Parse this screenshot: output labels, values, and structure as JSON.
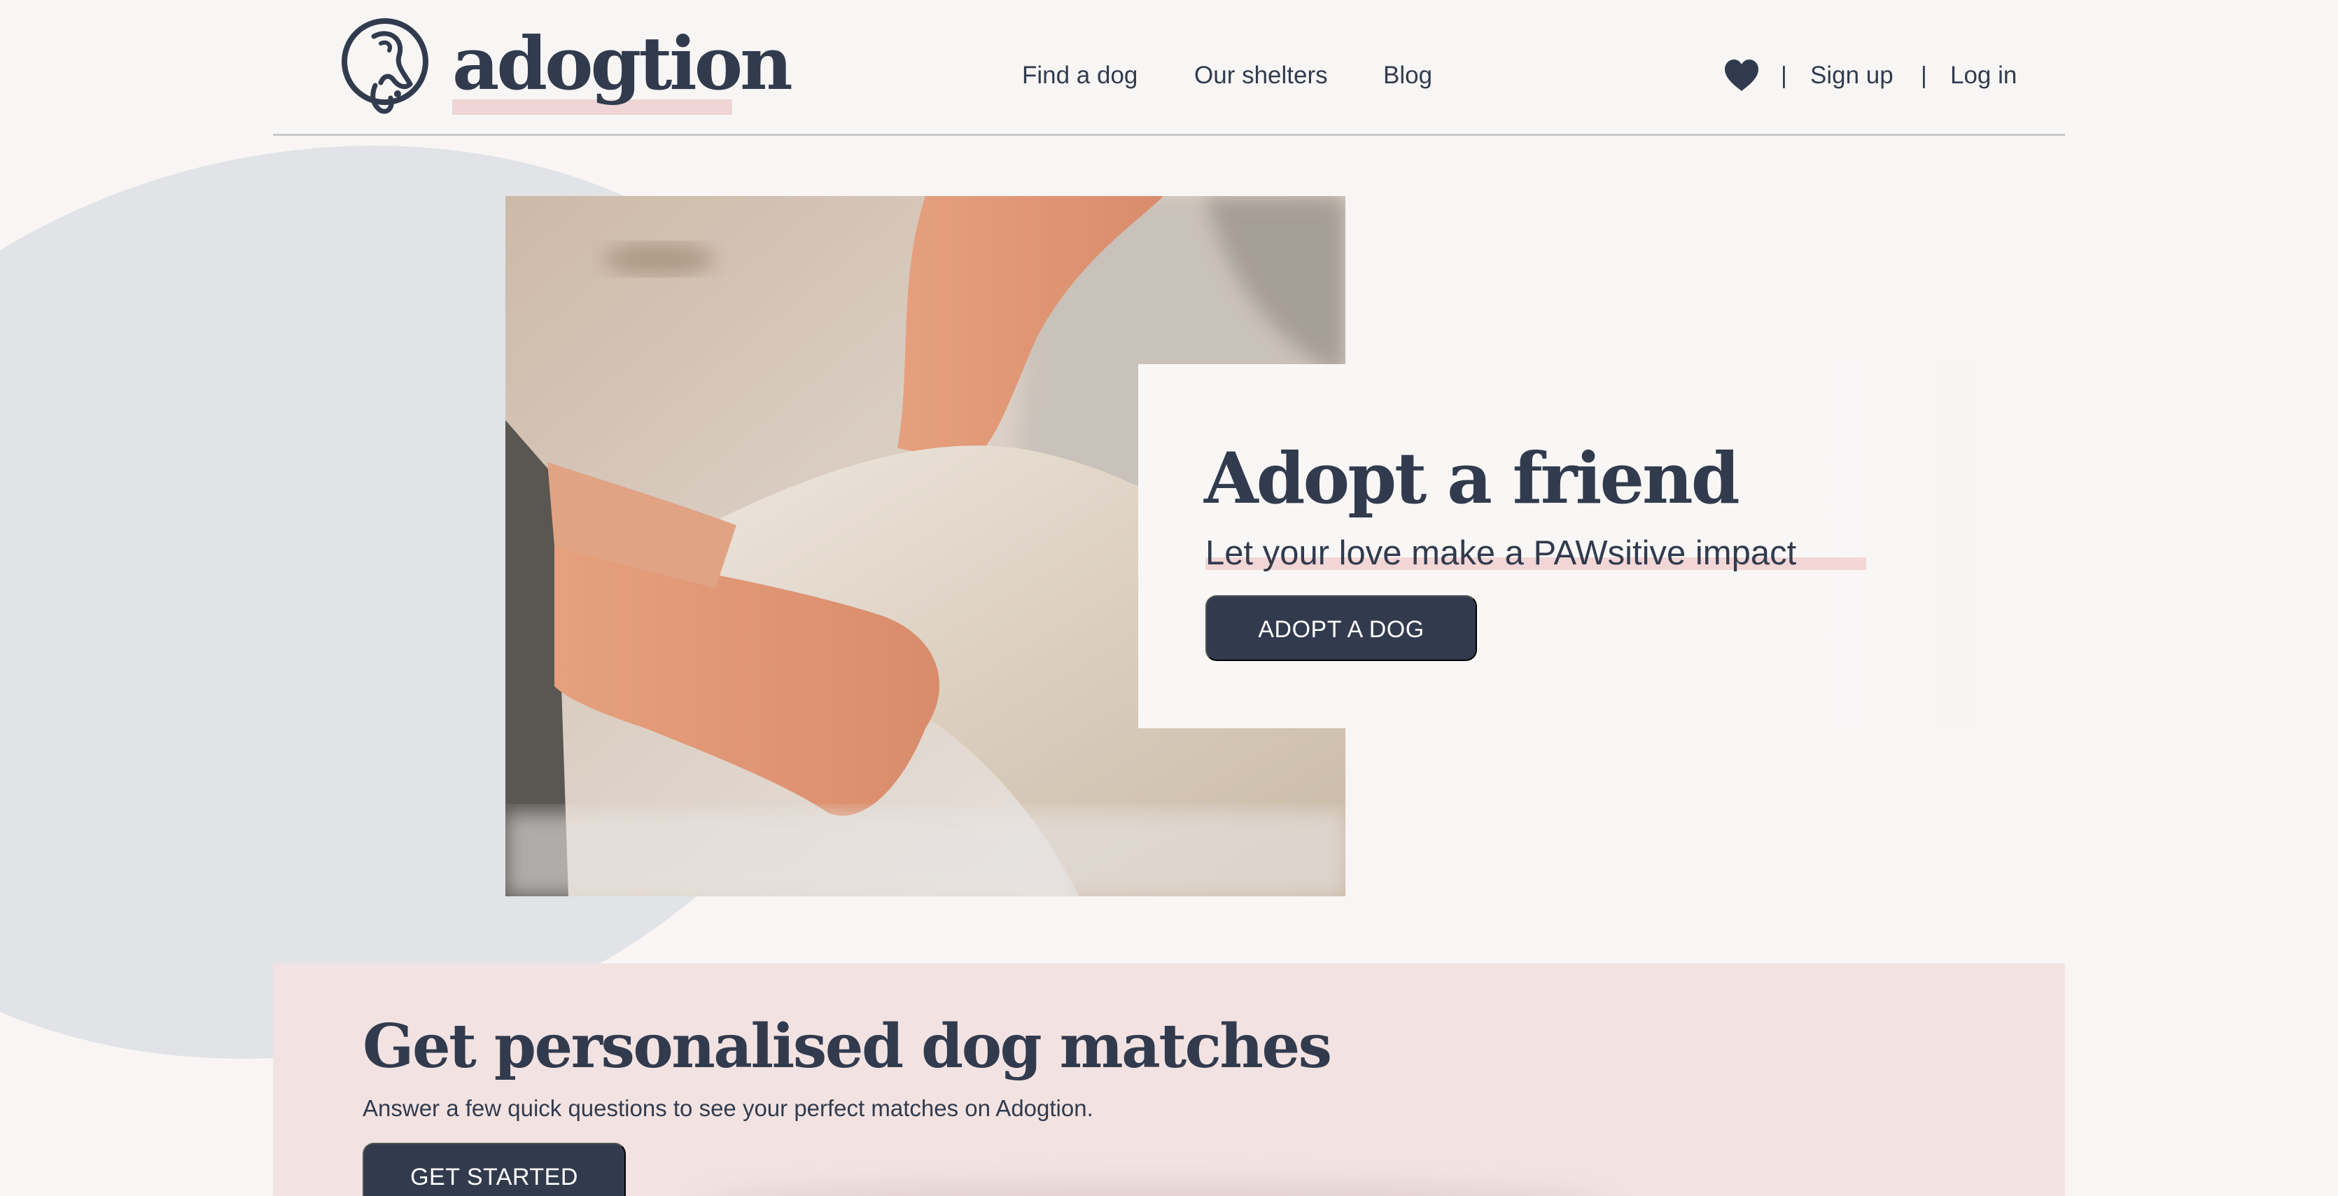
{
  "header": {
    "logo_text": "adogtion",
    "nav": {
      "find_a_dog": "Find a dog",
      "our_shelters": "Our shelters",
      "blog": "Blog"
    },
    "separator": "|",
    "sign_up": "Sign up",
    "log_in": "Log in",
    "icons": {
      "logo": "dog-logo-icon",
      "favorites": "heart-icon"
    }
  },
  "hero": {
    "title": "Adopt a friend",
    "subtitle": "Let your love make a PAWsitive impact",
    "cta_label": "ADOPT A DOG",
    "image": "person-hugging-dog-photo"
  },
  "matches": {
    "title": "Get personalised dog matches",
    "description": "Answer a few quick questions to see your perfect matches on Adogtion.",
    "cta_label": "GET STARTED"
  },
  "colors": {
    "primary": "#323b4e",
    "highlight": "#efd5d6",
    "background": "#f8f5f4",
    "blob": "#e1e3e7",
    "section_bg": "#f2e3e2"
  }
}
